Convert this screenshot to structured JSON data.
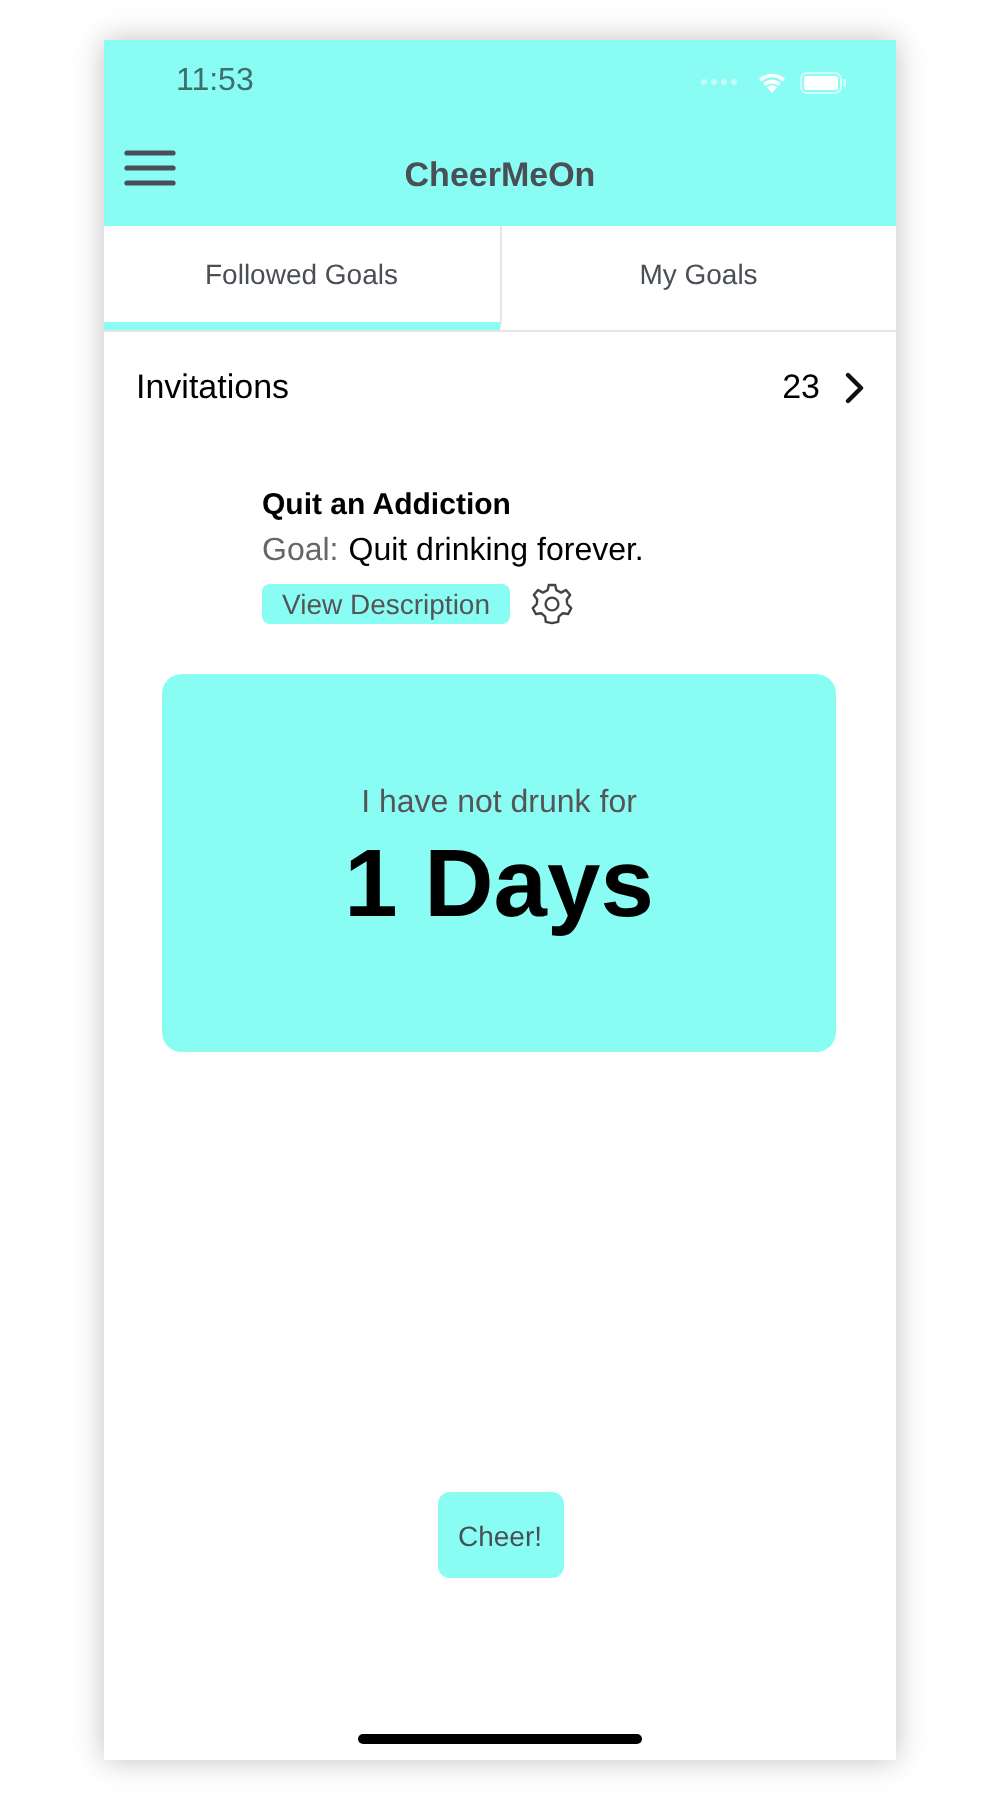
{
  "status_bar": {
    "time": "11:53"
  },
  "header": {
    "title": "CheerMeOn"
  },
  "tabs": [
    {
      "label": "Followed Goals",
      "selected": true
    },
    {
      "label": "My Goals",
      "selected": false
    }
  ],
  "invitations": {
    "label": "Invitations",
    "count": "23"
  },
  "goal": {
    "category": "Quit an Addiction",
    "goal_label": "Goal:",
    "goal_text": "Quit drinking forever.",
    "description_button": "View Description"
  },
  "counter": {
    "caption": "I have not drunk for",
    "value": "1 Days"
  },
  "cheer_button": "Cheer!"
}
